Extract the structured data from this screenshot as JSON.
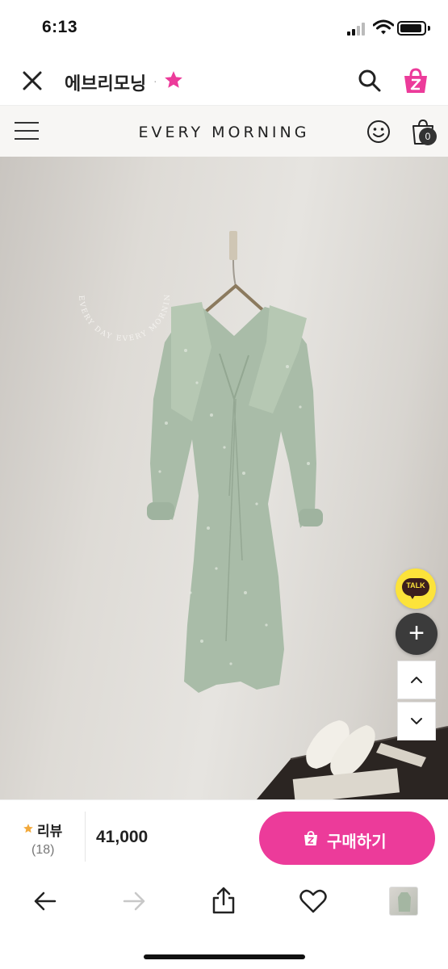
{
  "status_bar": {
    "time": "6:13"
  },
  "app_header": {
    "store_name": "에브리모닝",
    "favorite_color": "#ec3b9a",
    "icons": [
      "close-icon",
      "star-icon",
      "search-icon",
      "zigzag-bag-icon"
    ]
  },
  "web_header": {
    "brand": "EVERY MORNING",
    "cart_count": "0",
    "icons": [
      "hamburger-menu-icon",
      "smile-icon",
      "shopping-bag-icon"
    ]
  },
  "product": {
    "stamp_text": "EVERY DAY EVERY MORNING",
    "floating": {
      "talk_label": "TALK",
      "plus_label": "+"
    }
  },
  "purchase_bar": {
    "review_label": "리뷰",
    "review_count": "(18)",
    "price": "41,000",
    "buy_label": "구매하기",
    "accent_color": "#ec3b9a"
  },
  "bottom_nav": {
    "icons": [
      "back-arrow-icon",
      "forward-arrow-icon",
      "share-icon",
      "heart-icon",
      "thumbnail"
    ]
  }
}
